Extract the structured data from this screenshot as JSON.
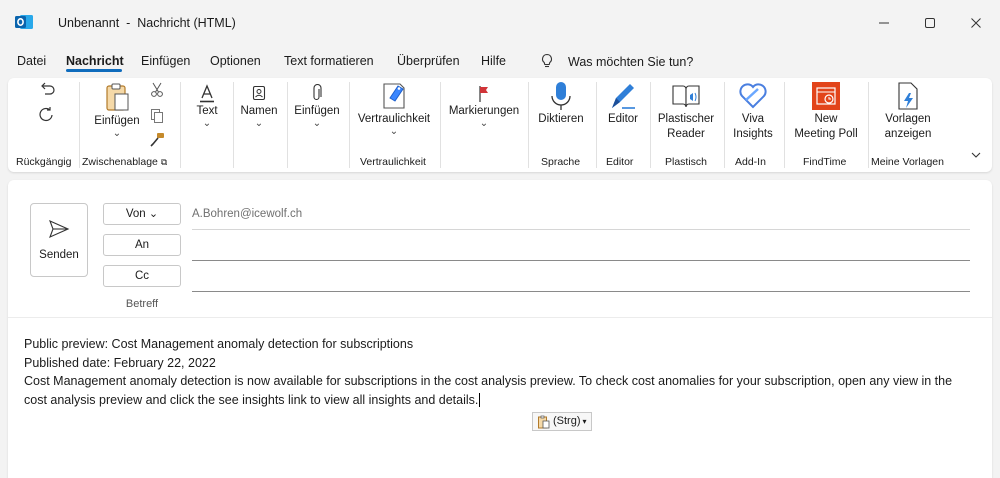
{
  "window": {
    "title": "Unbenannt  -  Nachricht (HTML)",
    "icons": {
      "app": "outlook-icon",
      "minimize": "minimize-icon",
      "maximize": "maximize-icon",
      "close": "close-icon"
    }
  },
  "menu": {
    "tabs": [
      "Datei",
      "Nachricht",
      "Einfügen",
      "Optionen",
      "Text formatieren",
      "Überprüfen",
      "Hilfe"
    ],
    "active_tab": "Nachricht",
    "tell_me": "Was möchten Sie tun?",
    "tell_me_icon": "lightbulb-icon"
  },
  "ribbon": {
    "undo": {
      "group": "Rückgängig"
    },
    "clipboard": {
      "paste_label": "Einfügen",
      "group": "Zwischenablage"
    },
    "text": {
      "label": "Text"
    },
    "names": {
      "label": "Namen"
    },
    "insert": {
      "label": "Einfügen"
    },
    "sensitivity": {
      "label": "Vertraulichkeit",
      "group": "Vertraulichkeit"
    },
    "tags": {
      "label": "Markierungen"
    },
    "dictate": {
      "label": "Diktieren",
      "group": "Sprache"
    },
    "editor": {
      "label": "Editor",
      "group": "Editor"
    },
    "immersive_reader": {
      "label_line1": "Plastischer",
      "label_line2": "Reader",
      "group": "Plastisch"
    },
    "viva": {
      "label_line1": "Viva",
      "label_line2": "Insights",
      "group": "Add-In"
    },
    "meeting_poll": {
      "label_line1": "New",
      "label_line2": "Meeting Poll",
      "group": "FindTime"
    },
    "templates": {
      "label_line1": "Vorlagen",
      "label_line2": "anzeigen",
      "group": "Meine Vorlagen"
    }
  },
  "compose": {
    "send_label": "Senden",
    "from_label": "Von",
    "from_value": "A.Bohren@icewolf.ch",
    "to_label": "An",
    "cc_label": "Cc",
    "subject_label": "Betreff",
    "to_value": "",
    "cc_value": "",
    "subject_value": ""
  },
  "body": {
    "line1": "Public preview: Cost Management anomaly detection for subscriptions",
    "line2": "Published date: February 22, 2022",
    "line3": "Cost Management anomaly detection is now available for subscriptions in the cost analysis preview. To check cost anomalies for your subscription, open any view in the cost analysis preview and click the see insights link to view all insights and details."
  },
  "paste_options": {
    "label": "(Strg)",
    "icon": "clipboard-icon"
  }
}
